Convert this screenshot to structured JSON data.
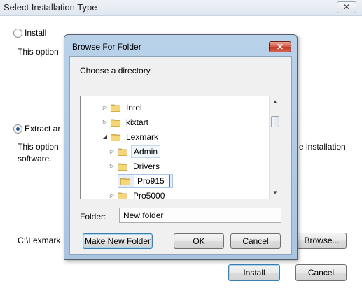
{
  "installer": {
    "title": "Select Installation Type",
    "close_label": "✕",
    "install_option": {
      "label": "Install",
      "description": "This option"
    },
    "extract_option": {
      "label": "Extract ar",
      "description_line1": "This option",
      "description_line1_right": "e installation",
      "description_line2": "software."
    },
    "path_value": "C:\\Lexmark",
    "browse_label": "Browse...",
    "install_button": "Install",
    "cancel_button": "Cancel"
  },
  "dialog": {
    "title": "Browse For Folder",
    "close_label": "✕",
    "prompt": "Choose a directory.",
    "tree_items": [
      {
        "label": "Intel",
        "expander": "closed"
      },
      {
        "label": "kixtart",
        "expander": "closed"
      },
      {
        "label": "Lexmark",
        "expander": "open"
      },
      {
        "label": "Admin",
        "expander": "closed"
      },
      {
        "label": "Drivers",
        "expander": "closed"
      },
      {
        "label": "Pro915",
        "expander": "none",
        "editing": true
      },
      {
        "label": "Pro5000",
        "expander": "closed"
      }
    ],
    "folder_label": "Folder:",
    "folder_value": "New folder",
    "make_new_folder_label": "Make New Folder",
    "ok_label": "OK",
    "cancel_label": "Cancel"
  },
  "colors": {
    "folder_icon": "#e8c35a",
    "dialog_frame": "#b9d2ea",
    "close_button": "#c94a35"
  }
}
